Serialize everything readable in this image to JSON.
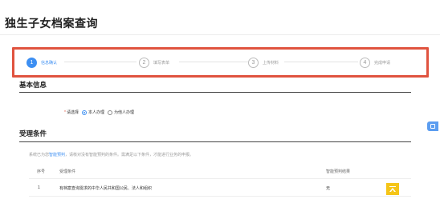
{
  "page": {
    "title": "独生子女档案查询"
  },
  "steps": [
    {
      "number": "1",
      "label": "信息确认"
    },
    {
      "number": "2",
      "label": "填写表单"
    },
    {
      "number": "3",
      "label": "上传材料"
    },
    {
      "number": "4",
      "label": "完成申请"
    }
  ],
  "basic_info": {
    "title": "基本信息",
    "applicant_label": "请选择",
    "options": [
      "本人办理",
      "为他人办理"
    ],
    "selected": "本人办理"
  },
  "conditions": {
    "title": "受理条件",
    "notice_prefix": "系统已为您",
    "notice_link": "智能预判",
    "notice_suffix": "，请核对没有智能预判的条件。需满足以下条件，才能进行业务的申报。",
    "columns": {
      "index": "序号",
      "condition": "受理条件",
      "result": "智能预判结果"
    },
    "rows": [
      {
        "index": "1",
        "condition": "有档案查询需求的中华人民共和国公民、法人和组织",
        "result": "无"
      }
    ]
  },
  "colors": {
    "accent": "#3d8ff2",
    "highlight_border": "#e0533f",
    "top_button": "#f5c518"
  },
  "icons": {
    "side": "document-icon",
    "top": "back-to-top-icon"
  }
}
